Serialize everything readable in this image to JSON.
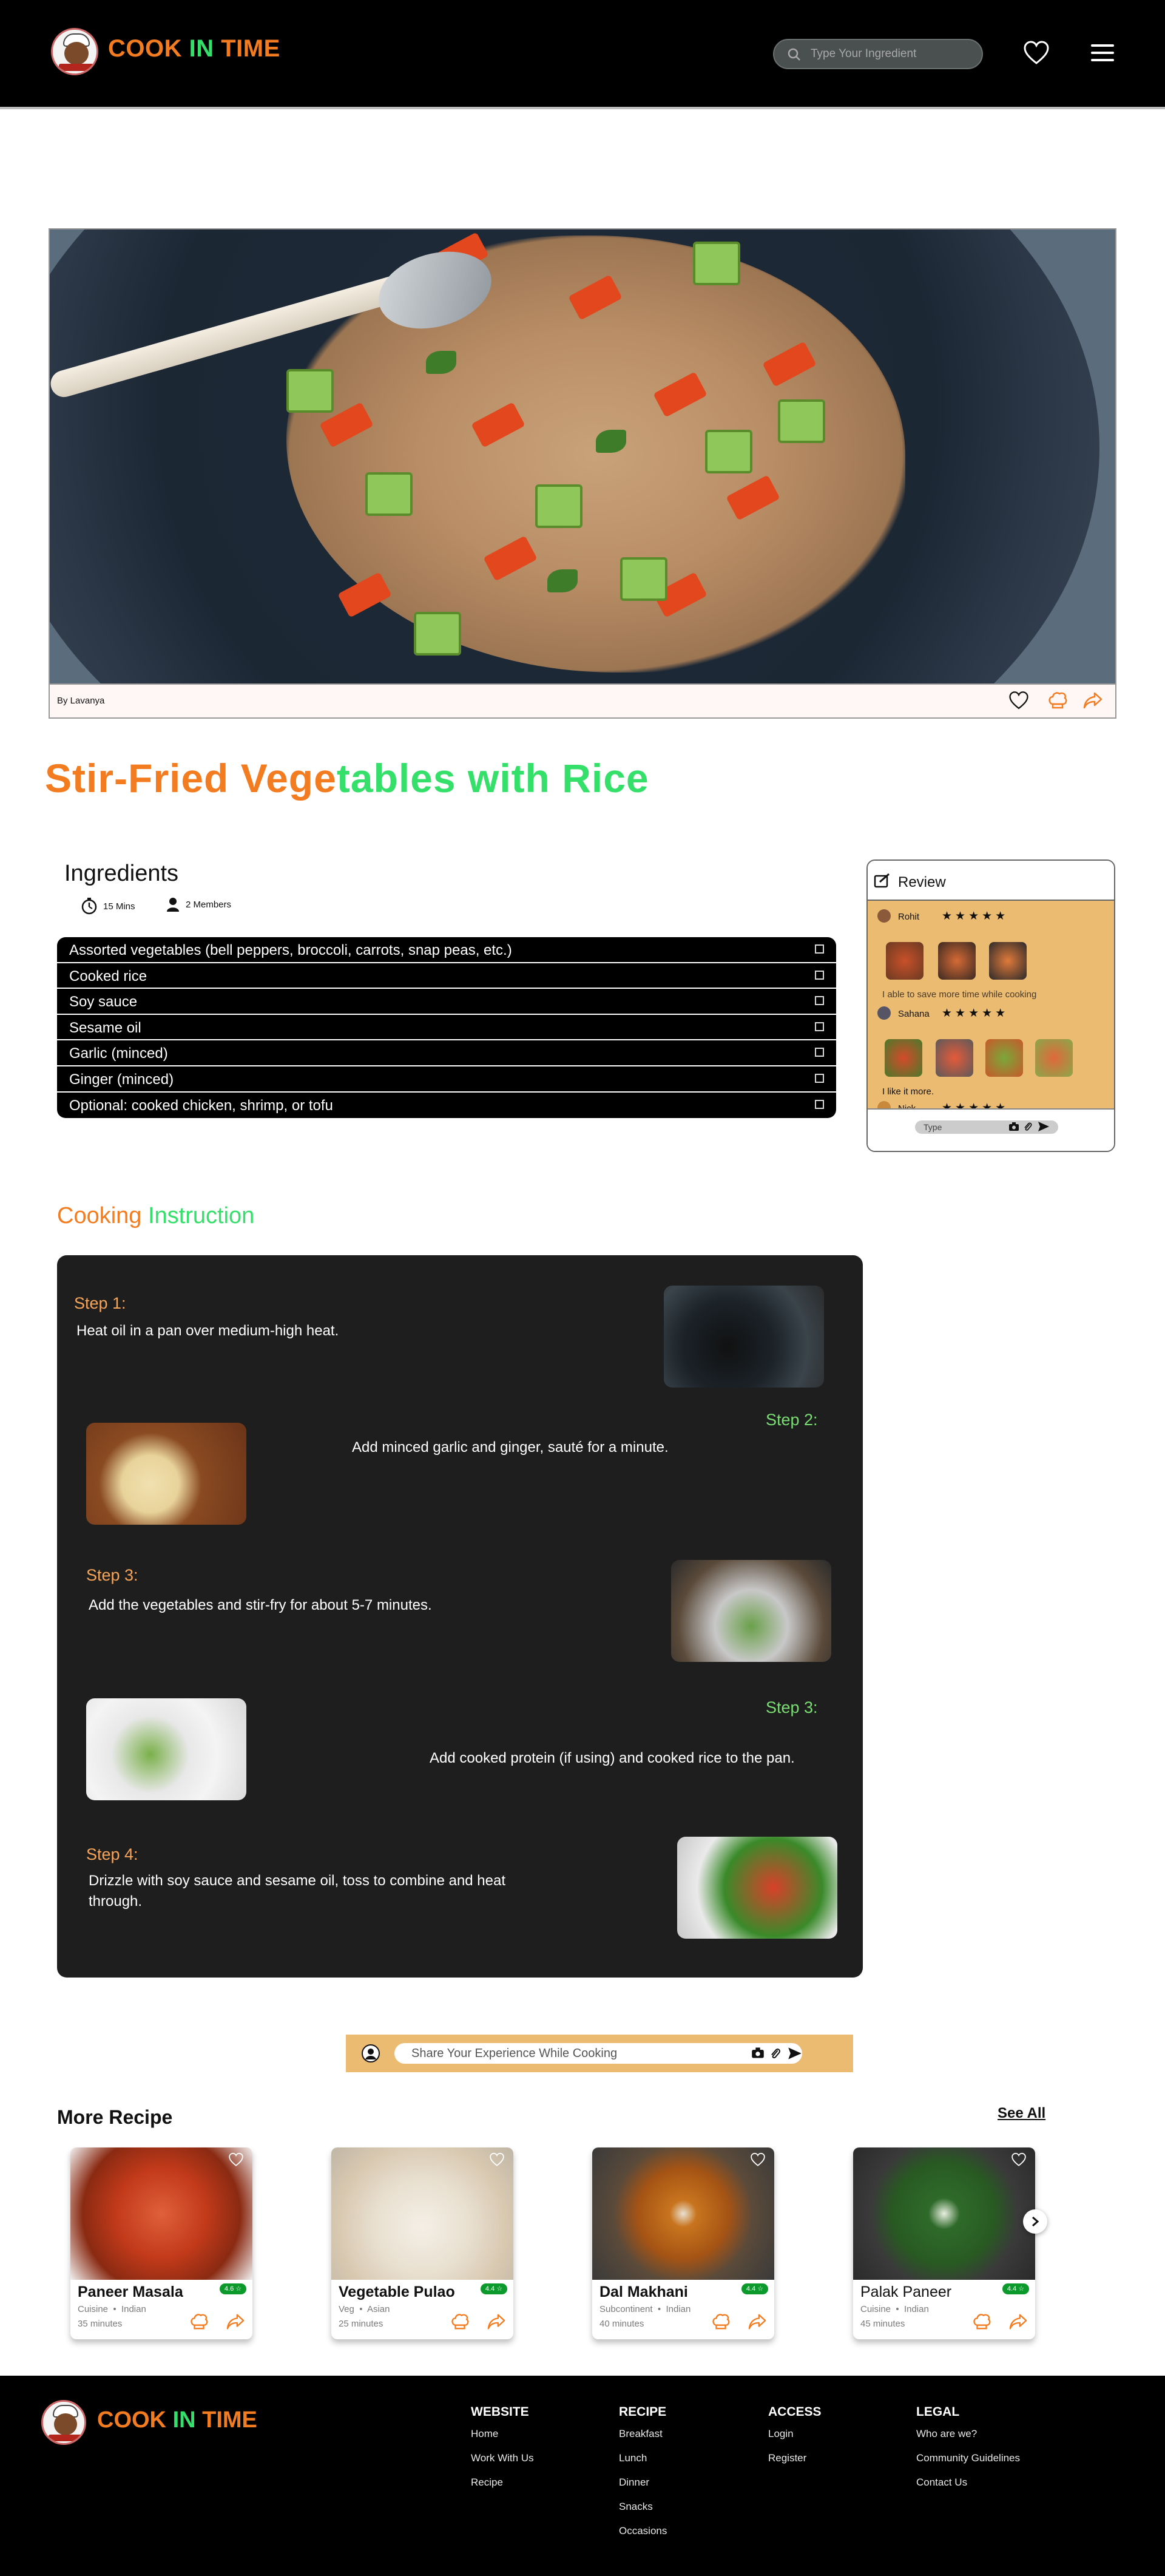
{
  "brand": {
    "part1": "COOK ",
    "part2": "IN",
    "part3": " TIME"
  },
  "header": {
    "search_placeholder": "Type Your Ingredient"
  },
  "hero": {
    "author": "By Lavanya"
  },
  "recipe": {
    "title_part1": "Stir-Fried Vege",
    "title_part2": "tables with Rice"
  },
  "ingredients": {
    "title": "Ingredients",
    "time": "15 Mins",
    "members": "2 Members",
    "items": [
      "Assorted vegetables (bell peppers, broccoli, carrots, snap peas, etc.)",
      "Cooked rice",
      "Soy sauce",
      "Sesame oil",
      "Garlic (minced)",
      "Ginger (minced)",
      "Optional: cooked chicken, shrimp, or tofu"
    ]
  },
  "review": {
    "title": "Review",
    "reviews": [
      {
        "name": "Rohit",
        "stars": "★★★★★",
        "text": "I able to save more time while cooking"
      },
      {
        "name": "Sahana",
        "stars": "★★★★★",
        "text": "I like it more."
      },
      {
        "name": "Nick",
        "stars": "★★★★★"
      }
    ],
    "input_placeholder": "Type"
  },
  "instructions": {
    "title_part1": "Cooking",
    "title_part2": " Instruction",
    "steps": [
      {
        "label": "Step 1:",
        "text": "Heat oil in a pan over medium-high heat."
      },
      {
        "label": "Step 2:",
        "text": "Add minced garlic and ginger, sauté for a minute."
      },
      {
        "label": "Step 3:",
        "text": "Add the vegetables and stir-fry for about 5-7 minutes."
      },
      {
        "label": "Step 3:",
        "text": "Add cooked protein (if using) and cooked rice to the pan."
      },
      {
        "label": "Step 4:",
        "text": "Drizzle with soy sauce and sesame oil, toss to combine and heat through."
      }
    ]
  },
  "share": {
    "placeholder": "Share Your Experience While Cooking"
  },
  "more": {
    "title": "More Recipe",
    "see_all": "See All",
    "cards": [
      {
        "name": "Paneer Masala",
        "rating": "4.6 ☆",
        "cuisine": "Cuisine",
        "origin": "Indian",
        "time": "35 minutes"
      },
      {
        "name": "Vegetable Pulao",
        "rating": "4.4 ☆",
        "cuisine": "Veg",
        "origin": "Asian",
        "time": "25 minutes"
      },
      {
        "name": "Dal Makhani",
        "rating": "4.4 ☆",
        "cuisine": "Subcontinent",
        "origin": "Indian",
        "time": "40 minutes"
      },
      {
        "name": "Palak Paneer",
        "rating": "4.4 ☆",
        "cuisine": "Cuisine",
        "origin": "Indian",
        "time": "45 minutes"
      }
    ]
  },
  "footer": {
    "columns": [
      {
        "title": "WEBSITE",
        "links": [
          "Home",
          "Work With Us",
          "Recipe"
        ]
      },
      {
        "title": "RECIPE",
        "links": [
          "Breakfast",
          "Lunch",
          "Dinner",
          "Snacks",
          "Occasions"
        ]
      },
      {
        "title": "ACCESS",
        "links": [
          "Login",
          "Register"
        ]
      },
      {
        "title": "LEGAL",
        "links": [
          "Who are we?",
          "Community Guidelines",
          "Contact Us"
        ]
      }
    ]
  },
  "colors": {
    "accent_orange": "#f47c20",
    "accent_green": "#35e06a",
    "review_bg": "#ebbb72",
    "steps_bg": "#1e1e1e"
  }
}
